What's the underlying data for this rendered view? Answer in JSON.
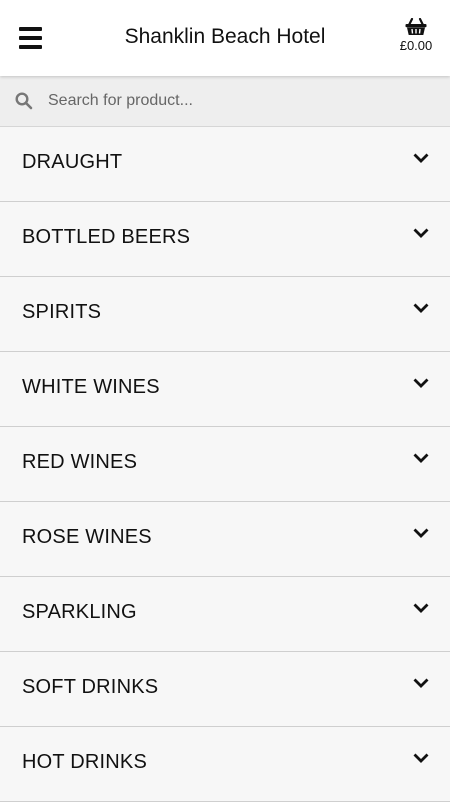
{
  "header": {
    "title": "Shanklin Beach Hotel",
    "menu_icon": "hamburger-menu-icon",
    "basket_icon": "shopping-basket-icon",
    "basket_total": "£0.00"
  },
  "search": {
    "placeholder": "Search for product...",
    "value": "",
    "icon": "search-icon"
  },
  "categories": [
    {
      "label": "DRAUGHT"
    },
    {
      "label": "BOTTLED BEERS"
    },
    {
      "label": "SPIRITS"
    },
    {
      "label": "WHITE WINES"
    },
    {
      "label": "RED WINES"
    },
    {
      "label": "ROSE WINES"
    },
    {
      "label": "SPARKLING"
    },
    {
      "label": "SOFT DRINKS"
    },
    {
      "label": "HOT DRINKS"
    }
  ],
  "colors": {
    "header_bg": "#ffffff",
    "page_bg": "#f7f7f7",
    "search_bg": "#eeeeee",
    "text": "#111111",
    "divider": "#cfcfcf"
  }
}
